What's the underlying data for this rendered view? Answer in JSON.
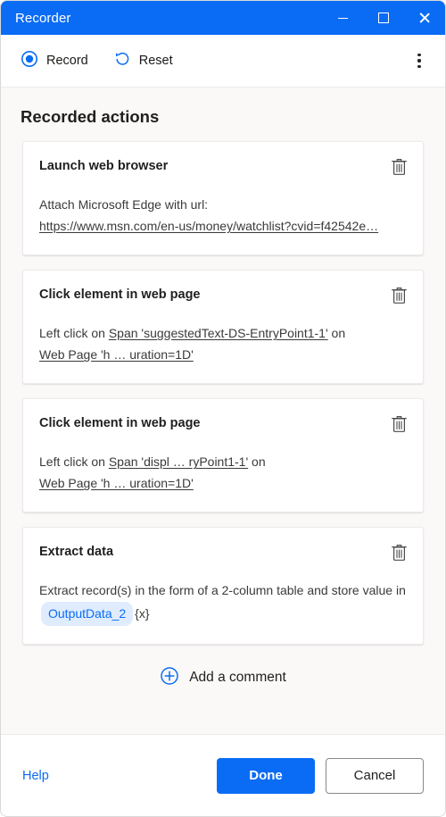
{
  "window": {
    "title": "Recorder",
    "controls": {
      "minimize": "Minimize",
      "maximize": "Maximize",
      "close": "Close"
    },
    "accent_color": "#0a6cf5",
    "background_color": "#faf9f8"
  },
  "toolbar": {
    "record_label": "Record",
    "record_icon": "record-circle-icon",
    "reset_label": "Reset",
    "reset_icon": "reset-arrow-icon",
    "more_icon": "more-vertical-icon"
  },
  "main": {
    "section_title": "Recorded actions",
    "cards": [
      {
        "title": "Launch web browser",
        "delete_icon": "trash-icon",
        "lines": [
          [
            {
              "type": "text",
              "value": "Attach Microsoft Edge with url:"
            }
          ],
          [
            {
              "type": "link",
              "value": "https://www.msn.com/en-us/money/watchlist?cvid=f42542e…"
            }
          ]
        ]
      },
      {
        "title": "Click element in web page",
        "delete_icon": "trash-icon",
        "lines": [
          [
            {
              "type": "text",
              "value": "Left click on "
            },
            {
              "type": "link",
              "value": "Span 'suggestedText-DS-EntryPoint1-1'"
            },
            {
              "type": "text",
              "value": " on"
            }
          ],
          [
            {
              "type": "link",
              "value": "Web Page 'h … uration=1D'"
            }
          ]
        ]
      },
      {
        "title": "Click element in web page",
        "delete_icon": "trash-icon",
        "lines": [
          [
            {
              "type": "text",
              "value": "Left click on "
            },
            {
              "type": "link",
              "value": "Span 'displ … ryPoint1-1'"
            },
            {
              "type": "text",
              "value": " on"
            }
          ],
          [
            {
              "type": "link",
              "value": "Web Page 'h … uration=1D'"
            }
          ]
        ]
      },
      {
        "title": "Extract data",
        "delete_icon": "trash-icon",
        "lines": [
          [
            {
              "type": "text",
              "value": "Extract record(s) in the form of a 2-column table and store value in "
            },
            {
              "type": "chip",
              "value": "OutputData_2"
            },
            {
              "type": "braces",
              "value": "{x}"
            }
          ]
        ]
      }
    ],
    "add_comment_label": "Add a comment",
    "add_comment_icon": "circle-plus-icon"
  },
  "footer": {
    "help_label": "Help",
    "done_label": "Done",
    "cancel_label": "Cancel"
  }
}
